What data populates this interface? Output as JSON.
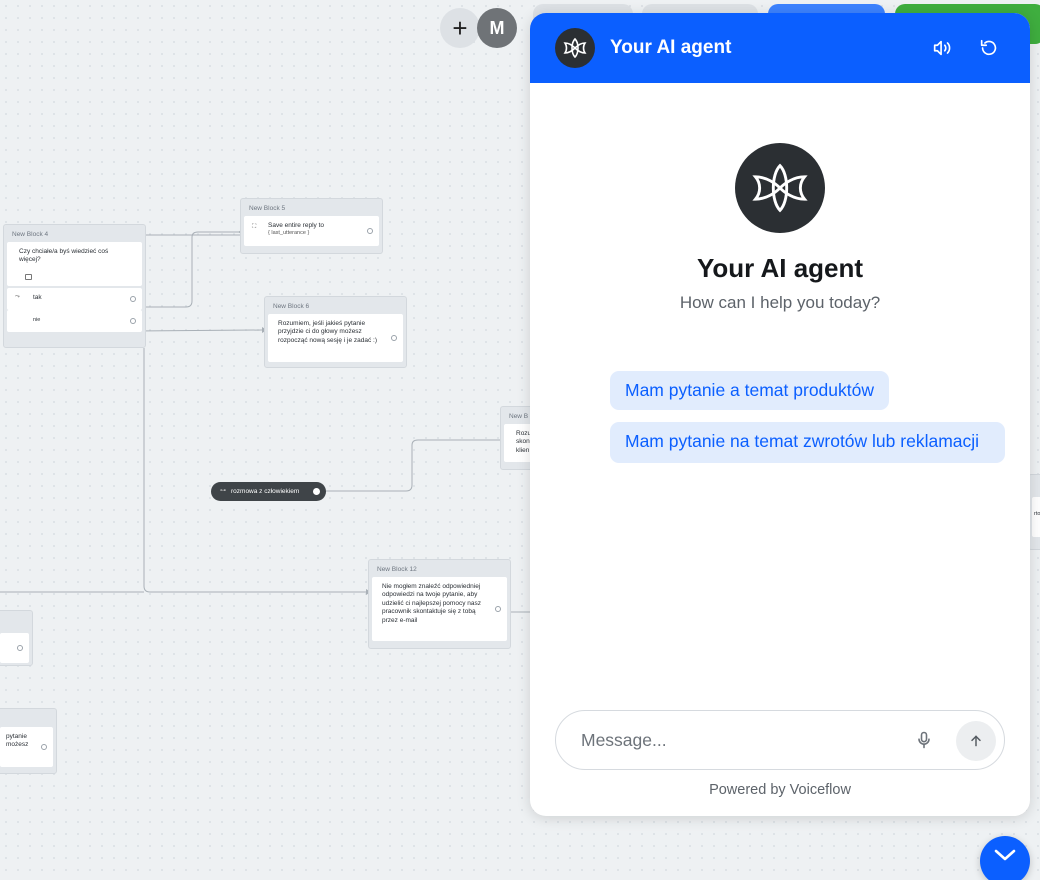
{
  "toolbar": {
    "add_symbol": "+",
    "avatar_initial": "M"
  },
  "canvas": {
    "block4": {
      "title": "New Block 4",
      "question": "Czy chciałe/a byś wiedzieć coś więcej?",
      "choice_yes": "tak",
      "choice_no": "nie"
    },
    "block5": {
      "title": "New Block 5",
      "text": "Save entire reply to",
      "variable": "{ last_utterance }"
    },
    "block6": {
      "title": "New Block 6",
      "text": "Rozumiem, jeśli jakieś pytanie przyjdzie ci do głowy możesz rozpocząć nową sesję i je zadać :)"
    },
    "block_partial_right": {
      "title": "New B",
      "line1": "Rozu",
      "line2": "skon",
      "line3": "klien"
    },
    "pill": {
      "label": "rozmowa z człowiekiem"
    },
    "block12": {
      "title": "New Block 12",
      "text": "Nie mogłem znaleźć odpowiedniej odpowiedzi na twoje pytanie, aby udzielić ci najlepszej pomocy nasz pracownik skontaktuje się z tobą przez e-mail"
    },
    "block_partial_left": {
      "line1": "pytanie",
      "line2": "możesz"
    },
    "edge_partial": {
      "text": "rto"
    }
  },
  "chat": {
    "header_title": "Your AI agent",
    "welcome_title": "Your AI agent",
    "welcome_subtitle": "How can I help you today?",
    "quick_replies": [
      "Mam pytanie a temat produktów",
      "Mam pytanie na temat zwrotów lub reklamacji"
    ],
    "input_placeholder": "Message...",
    "powered_by": "Powered by Voiceflow"
  },
  "colors": {
    "primary": "#0b5fff",
    "logo_bg": "#2b2f33",
    "quick_reply_bg": "#e1ecfd",
    "canvas_bg": "#eef1f3"
  },
  "icons": {
    "header_logo": "voiceflow-logo-icon",
    "sound": "speaker-icon",
    "reset": "reset-icon",
    "mic": "microphone-icon",
    "send": "arrow-up-icon",
    "fab": "chevron-down-icon"
  }
}
